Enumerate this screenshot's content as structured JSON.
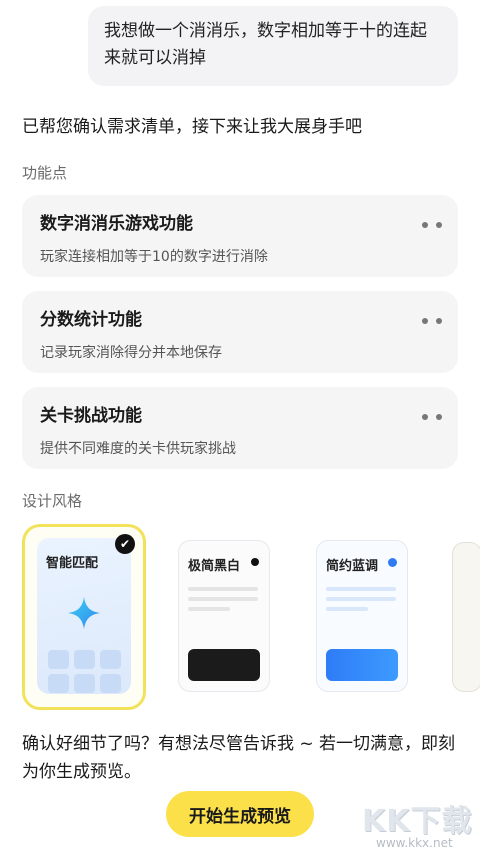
{
  "chat": {
    "user_message": "我想做一个消消乐，数字相加等于十的连起来就可以消掉",
    "assistant_intro": "已帮您确认需求清单，接下来让我大展身手吧"
  },
  "features": {
    "section_title": "功能点",
    "items": [
      {
        "title": "数字消消乐游戏功能",
        "description": "玩家连接相加等于10的数字进行消除"
      },
      {
        "title": "分数统计功能",
        "description": "记录玩家消除得分并本地保存"
      },
      {
        "title": "关卡挑战功能",
        "description": "提供不同难度的关卡供玩家挑战"
      }
    ]
  },
  "design_style": {
    "section_title": "设计风格",
    "options": [
      {
        "label": "智能匹配",
        "selected": true,
        "accent": "#2aa6f0"
      },
      {
        "label": "极简黑白",
        "selected": false,
        "accent": "#111111"
      },
      {
        "label": "简约蓝调",
        "selected": false,
        "accent": "#2f7bf5"
      }
    ]
  },
  "confirm_text": "确认好细节了吗？有想法尽管告诉我 ~ 若一切满意，即刻为你生成预览。",
  "actions": {
    "preview_button_label": "开始生成预览"
  },
  "watermark": {
    "logo_text": "KK下载",
    "url": "www.kkx.net"
  },
  "colors": {
    "accent_yellow": "#fbe04a",
    "selected_border": "#f2e25a",
    "card_background": "#f5f5f6"
  }
}
